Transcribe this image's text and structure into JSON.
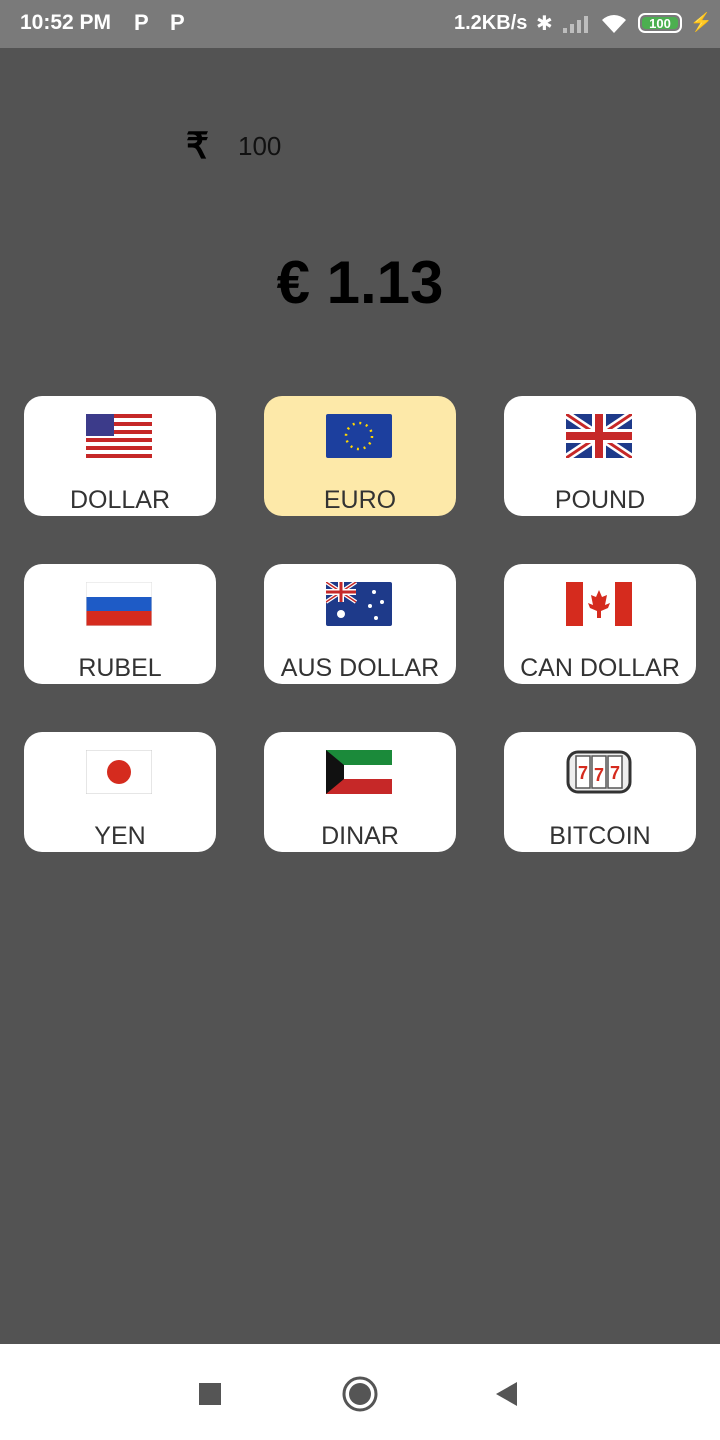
{
  "status": {
    "time": "10:52 PM",
    "notif_icons": [
      "P",
      "P"
    ],
    "netspeed": "1.2KB/s",
    "battery": "100"
  },
  "input": {
    "currency_symbol": "₹",
    "value": "100"
  },
  "result": "€ 1.13",
  "currencies": [
    {
      "label": "DOLLAR",
      "icon": "us-flag-icon",
      "selected": false
    },
    {
      "label": "EURO",
      "icon": "eu-flag-icon",
      "selected": true
    },
    {
      "label": "POUND",
      "icon": "uk-flag-icon",
      "selected": false
    },
    {
      "label": "RUBEL",
      "icon": "russia-flag-icon",
      "selected": false
    },
    {
      "label": "AUS DOLLAR",
      "icon": "australia-flag-icon",
      "selected": false
    },
    {
      "label": "CAN DOLLAR",
      "icon": "canada-flag-icon",
      "selected": false
    },
    {
      "label": "YEN",
      "icon": "japan-flag-icon",
      "selected": false
    },
    {
      "label": "DINAR",
      "icon": "kuwait-flag-icon",
      "selected": false
    },
    {
      "label": "BITCOIN",
      "icon": "slot-machine-icon",
      "selected": false
    }
  ],
  "colors": {
    "background": "#535353",
    "card": "#ffffff",
    "selected_card": "#fde9a9"
  }
}
